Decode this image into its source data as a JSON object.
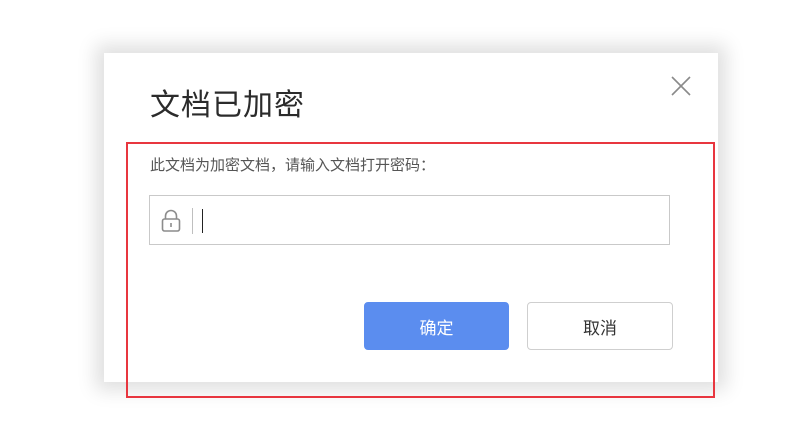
{
  "dialog": {
    "title": "文档已加密",
    "prompt": "此文档为加密文档，请输入文档打开密码：",
    "password": {
      "value": "",
      "placeholder": "",
      "icon": "lock-icon"
    },
    "buttons": {
      "ok_label": "确定",
      "cancel_label": "取消"
    },
    "close_icon": "close-icon"
  },
  "colors": {
    "primary_button": "#5b8def",
    "highlight_frame": "#e8363f"
  }
}
